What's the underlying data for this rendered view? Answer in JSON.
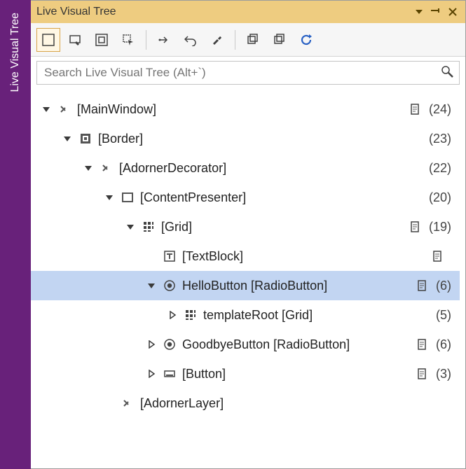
{
  "sidebar": {
    "tab_label": "Live Visual Tree"
  },
  "header": {
    "title": "Live Visual Tree"
  },
  "toolbar": {
    "buttons": [
      {
        "name": "scope-to-selection",
        "active": true
      },
      {
        "name": "select-element",
        "active": false
      },
      {
        "name": "show-layout-adorners",
        "active": false
      },
      {
        "name": "track-focused",
        "active": false
      },
      {
        "name": "sep"
      },
      {
        "name": "go-to-live-property",
        "active": false
      },
      {
        "name": "undo",
        "active": false
      },
      {
        "name": "settings",
        "active": false
      },
      {
        "name": "sep"
      },
      {
        "name": "collapse-all",
        "active": false
      },
      {
        "name": "expand-all",
        "active": false
      },
      {
        "name": "refresh",
        "active": false
      }
    ]
  },
  "search": {
    "placeholder": "Search Live Visual Tree (Alt+`)",
    "value": ""
  },
  "tree": {
    "rows": [
      {
        "depth": 0,
        "expander": "open",
        "icon": "angle",
        "label": "[MainWindow]",
        "hasDoc": true,
        "count": "(24)",
        "selected": false
      },
      {
        "depth": 1,
        "expander": "open",
        "icon": "border",
        "label": "[Border]",
        "hasDoc": false,
        "count": "(23)",
        "selected": false
      },
      {
        "depth": 2,
        "expander": "open",
        "icon": "angle",
        "label": "[AdornerDecorator]",
        "hasDoc": false,
        "count": "(22)",
        "selected": false
      },
      {
        "depth": 3,
        "expander": "open",
        "icon": "content",
        "label": "[ContentPresenter]",
        "hasDoc": false,
        "count": "(20)",
        "selected": false
      },
      {
        "depth": 4,
        "expander": "open",
        "icon": "grid",
        "label": "[Grid]",
        "hasDoc": true,
        "count": "(19)",
        "selected": false
      },
      {
        "depth": 5,
        "expander": "none",
        "icon": "text",
        "label": "[TextBlock]",
        "hasDoc": true,
        "count": "",
        "selected": false
      },
      {
        "depth": 5,
        "expander": "open",
        "icon": "radio",
        "label": "HelloButton [RadioButton]",
        "hasDoc": true,
        "count": "(6)",
        "selected": true
      },
      {
        "depth": 6,
        "expander": "closed",
        "icon": "grid",
        "label": "templateRoot [Grid]",
        "hasDoc": false,
        "count": "(5)",
        "selected": false
      },
      {
        "depth": 5,
        "expander": "closed",
        "icon": "radio",
        "label": "GoodbyeButton [RadioButton]",
        "hasDoc": true,
        "count": "(6)",
        "selected": false
      },
      {
        "depth": 5,
        "expander": "closed",
        "icon": "button",
        "label": "[Button]",
        "hasDoc": true,
        "count": "(3)",
        "selected": false
      },
      {
        "depth": 3,
        "expander": "none",
        "icon": "angle",
        "label": "[AdornerLayer]",
        "hasDoc": false,
        "count": "",
        "selected": false
      }
    ]
  }
}
